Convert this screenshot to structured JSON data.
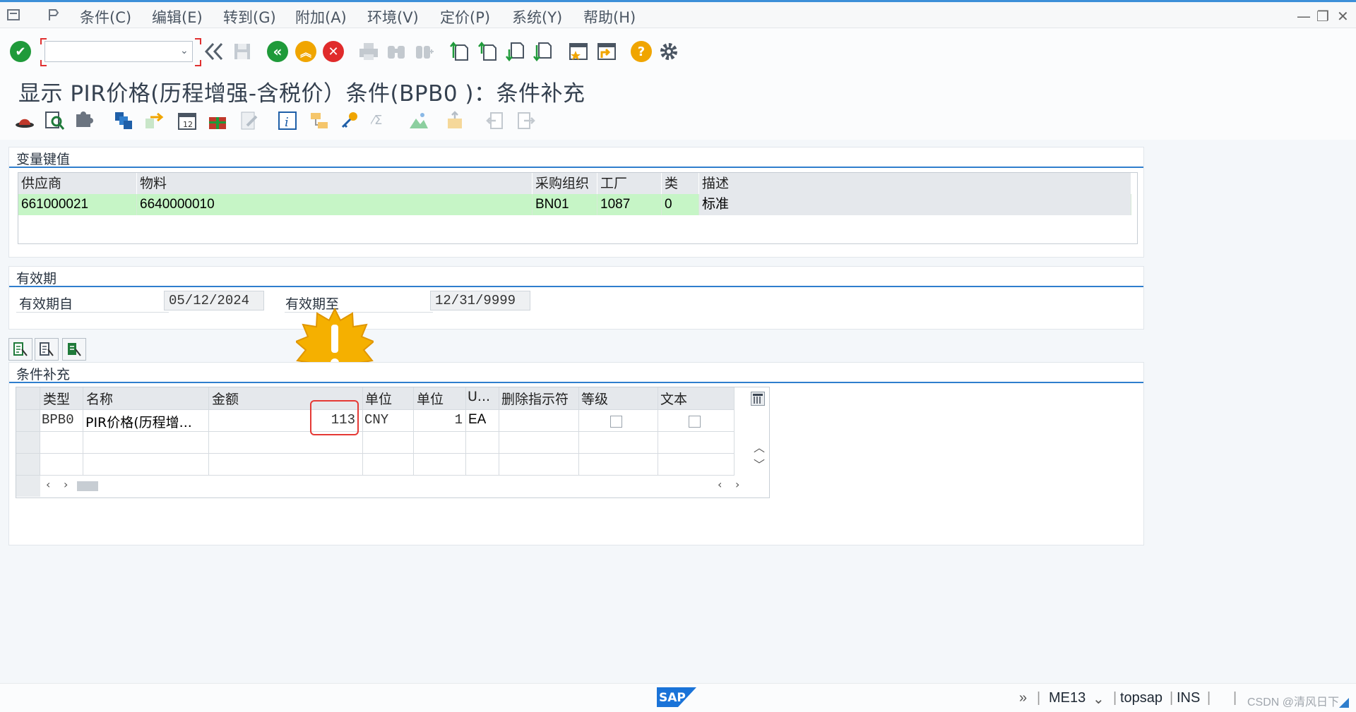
{
  "menu": {
    "items": [
      "条件(C)",
      "编辑(E)",
      "转到(G)",
      "附加(A)",
      "环境(V)",
      "定价(P)",
      "系统(Y)",
      "帮助(H)"
    ]
  },
  "toolbar": {
    "command_value": "",
    "icons": [
      "enter-icon",
      "back-double-icon",
      "save-icon",
      "back-icon",
      "exit-icon",
      "cancel-icon",
      "print-icon",
      "find-icon",
      "find-next-icon",
      "first-page-icon",
      "prev-page-icon",
      "next-page-icon",
      "last-page-icon",
      "new-session-icon",
      "shortcut-icon",
      "help-icon",
      "settings-icon"
    ]
  },
  "title": "显示 PIR价格(历程增强-含税价）条件(BPB0 )：条件补充",
  "variable_key": {
    "section_title": "变量键值",
    "headers": [
      "供应商",
      "物料",
      "采购组织",
      "工厂",
      "类",
      "描述"
    ],
    "row": [
      "661000021",
      "6640000010",
      "BN01",
      "1087",
      "0",
      "标准"
    ]
  },
  "validity": {
    "section_title": "有效期",
    "from_label": "有效期自",
    "from_value": "05/12/2024",
    "to_label": "有效期至",
    "to_value": "12/31/9999"
  },
  "supplements": {
    "section_title": "条件补充",
    "headers": [
      "类型",
      "名称",
      "金额",
      "单位",
      "单位",
      "U...",
      "删除指示符",
      "等级",
      "文本"
    ],
    "rows": [
      {
        "type": "BPB0",
        "name": "PIR价格(历程增...",
        "amount": "113",
        "currency": "CNY",
        "per": "1",
        "uom": "EA"
      }
    ]
  },
  "status": {
    "transaction": "ME13",
    "system": "topsap",
    "mode": "INS",
    "watermark": "CSDN @清风日下"
  },
  "colors": {
    "accent": "#2f7ecd",
    "highlight_row": "#c6f5c6",
    "callout": "#e53935",
    "warning": "#f5b000"
  }
}
